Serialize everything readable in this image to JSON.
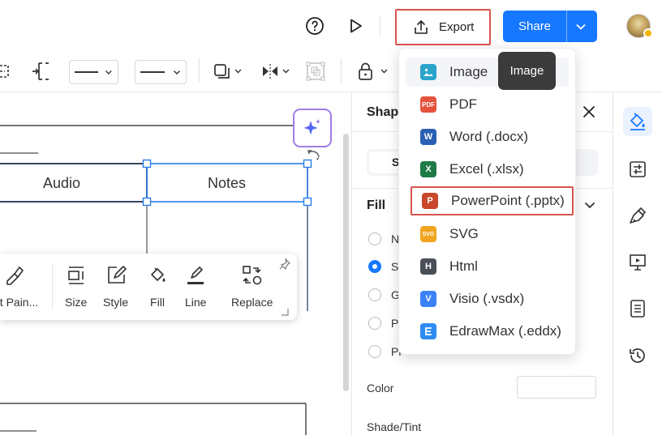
{
  "header": {
    "export_label": "Export",
    "share_label": "Share"
  },
  "canvas": {
    "cell_audio": "Audio",
    "cell_notes": "Notes"
  },
  "float_toolbar": {
    "items": [
      {
        "label": "at Pain...",
        "icon": "format-painter-icon"
      },
      {
        "label": "Size",
        "icon": "size-icon"
      },
      {
        "label": "Style",
        "icon": "style-icon"
      },
      {
        "label": "Fill",
        "icon": "fill-bucket-icon"
      },
      {
        "label": "Line",
        "icon": "line-pen-icon"
      },
      {
        "label": "Replace",
        "icon": "replace-icon"
      }
    ]
  },
  "panel": {
    "title": "Shap",
    "tab_active": "S",
    "fill_title": "Fill",
    "options": [
      "N",
      "S",
      "G",
      "P",
      "Pi"
    ],
    "selected_option": 1,
    "color_label": "Color",
    "shade_label": "Shade/Tint"
  },
  "export_menu": {
    "items": [
      {
        "label": "Image",
        "icon": "image-icon",
        "icon_text": "",
        "color": "#29a3c9"
      },
      {
        "label": "PDF",
        "icon": "pdf-icon",
        "icon_text": "PDF",
        "color": "#e5533d"
      },
      {
        "label": "Word (.docx)",
        "icon": "word-icon",
        "icon_text": "W",
        "color": "#2b5fb4"
      },
      {
        "label": "Excel (.xlsx)",
        "icon": "excel-icon",
        "icon_text": "X",
        "color": "#1f7a45"
      },
      {
        "label": "PowerPoint (.pptx)",
        "icon": "powerpoint-icon",
        "icon_text": "P",
        "color": "#c9472c"
      },
      {
        "label": "SVG",
        "icon": "svg-icon",
        "icon_text": "SVG",
        "color": "#f0a521"
      },
      {
        "label": "Html",
        "icon": "html-icon",
        "icon_text": "H",
        "color": "#4a4f57"
      },
      {
        "label": "Visio (.vsdx)",
        "icon": "visio-icon",
        "icon_text": "V",
        "color": "#3b82f6"
      },
      {
        "label": "EdrawMax (.eddx)",
        "icon": "edrawmax-icon",
        "icon_text": "",
        "color": "#2e8cf0"
      }
    ]
  },
  "tooltip": {
    "text": "Image"
  },
  "colors": {
    "accent": "#1677ff",
    "highlight_border": "#d9534f",
    "ai_border": "#a27ce6"
  }
}
